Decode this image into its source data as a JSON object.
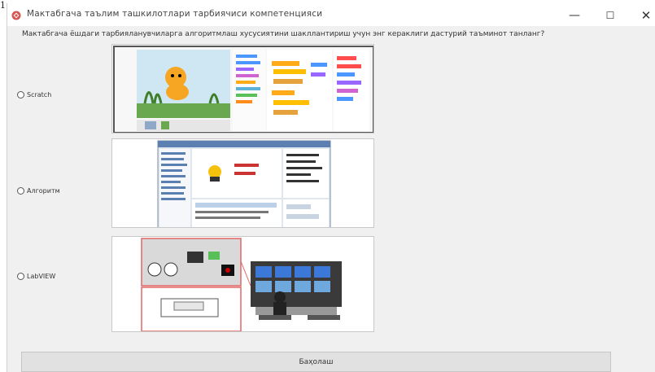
{
  "corner_digit": "1",
  "window": {
    "title": "Мактабгача таълим ташкилотлари тарбиячиси компетенцияси",
    "minimize": "—",
    "maximize": "☐",
    "close": "✕"
  },
  "question": "Мактабгача ёшдаги тарбияланувчиларга алгоритмлаш хусусиятини шакллантириш учун энг кераклиги дастурий таъминот танланг?",
  "options": [
    {
      "label": "Scratch"
    },
    {
      "label": "Алгоритм"
    },
    {
      "label": "LabVIEW"
    }
  ],
  "submit_label": "Баҳолаш",
  "colors": {
    "accent": "#d9534f",
    "window_bg": "#f0f0f0",
    "button_bg": "#e1e1e1"
  }
}
